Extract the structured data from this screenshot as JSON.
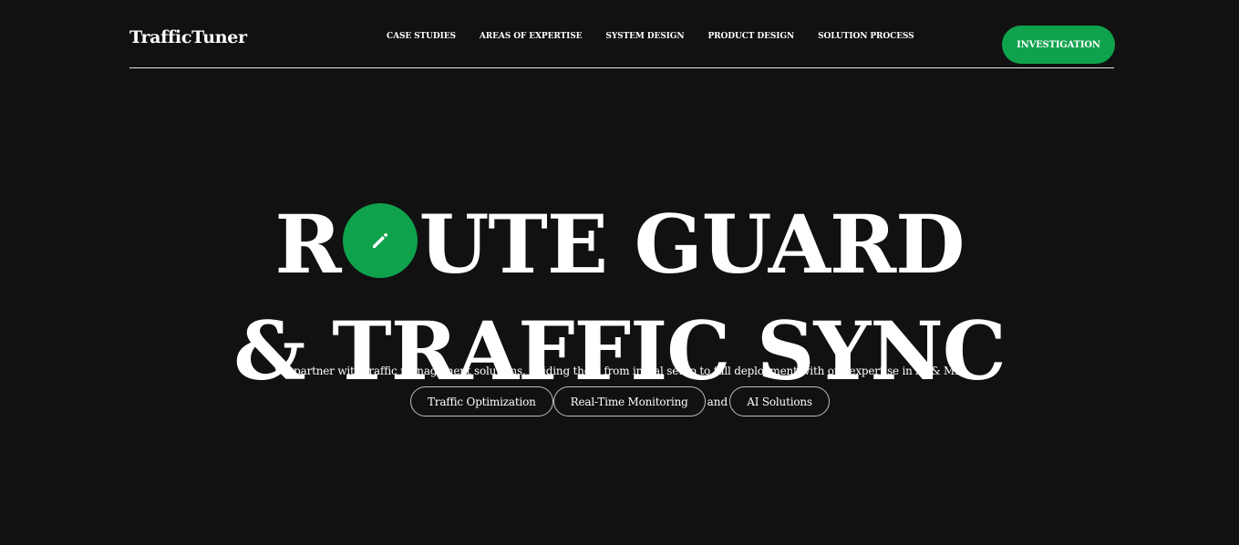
{
  "header": {
    "logo": "TrafficTuner",
    "nav": [
      {
        "label": "CASE STUDIES"
      },
      {
        "label": "AREAS OF EXPERTISE"
      },
      {
        "label": "SYSTEM DESIGN"
      },
      {
        "label": "PRODUCT DESIGN"
      },
      {
        "label": "SOLUTION PROCESS"
      }
    ],
    "cta_label": "INVESTIGATION"
  },
  "hero": {
    "line1_prefix": "R",
    "line1_suffix": "UTE GUARD",
    "line2": "& TRAFFIC SYNC",
    "subtitle": "We partner with traffic management solutions, guiding them from initial setup to full deployment with our expertise in AI & ML.",
    "chips": [
      {
        "label": "Traffic Optimization"
      },
      {
        "label": "Real-Time Monitoring"
      },
      {
        "label": "AI Solutions"
      }
    ],
    "chip_connector": "and"
  },
  "colors": {
    "background": "#111111",
    "accent": "#0fa24c",
    "text": "#ffffff"
  },
  "icons": {
    "hero_o": "pencil-icon"
  }
}
